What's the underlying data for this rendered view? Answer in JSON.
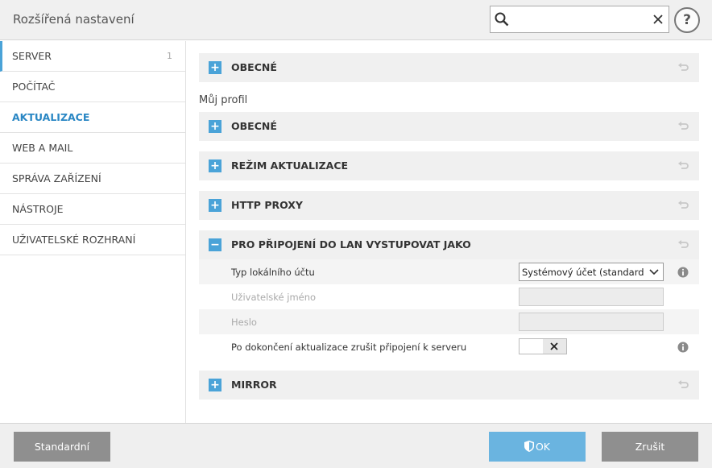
{
  "window": {
    "title": "Rozšířená nastavení"
  },
  "search": {
    "value": "",
    "placeholder": "",
    "icon": "search-icon",
    "clear_icon": "close-icon"
  },
  "help": {
    "label": "?"
  },
  "sidebar": {
    "items": [
      {
        "label": "SERVER",
        "count": "1"
      },
      {
        "label": "POČÍTAČ"
      },
      {
        "label": "AKTUALIZACE",
        "active": true
      },
      {
        "label": "WEB A MAIL"
      },
      {
        "label": "SPRÁVA ZAŘÍZENÍ"
      },
      {
        "label": "NÁSTROJE"
      },
      {
        "label": "UŽIVATELSKÉ ROZHRANÍ"
      }
    ]
  },
  "main": {
    "top_section": {
      "title": "OBECNÉ",
      "toggle": "+"
    },
    "profile_label": "Můj profil",
    "sections": [
      {
        "title": "OBECNÉ",
        "toggle": "+"
      },
      {
        "title": "REŽIM AKTUALIZACE",
        "toggle": "+"
      },
      {
        "title": "HTTP PROXY",
        "toggle": "+"
      },
      {
        "title": "PRO PŘIPOJENÍ DO LAN VYSTUPOVAT JAKO",
        "toggle": "−"
      },
      {
        "title": "MIRROR",
        "toggle": "+"
      }
    ],
    "lan_settings": {
      "account_type_label": "Typ lokálního účtu",
      "account_type_value": "Systémový účet (standard...",
      "username_label": "Uživatelské jméno",
      "password_label": "Heslo",
      "disconnect_label": "Po dokončení aktualizace zrušit připojení k serveru"
    }
  },
  "footer": {
    "default_label": "Standardní",
    "ok_label": "OK",
    "cancel_label": "Zrušit"
  },
  "colors": {
    "accent": "#4aa3d8",
    "ok_button": "#6ab4e0",
    "gray_button": "#8f8f8f"
  }
}
